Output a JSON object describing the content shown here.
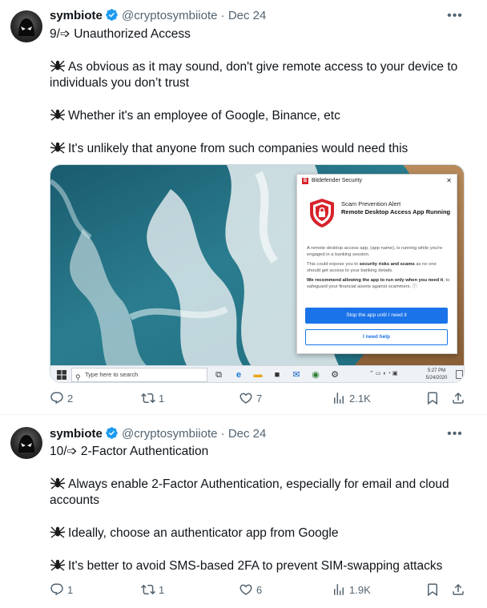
{
  "tweets": [
    {
      "author": {
        "name": "symbiote",
        "handle": "@cryptosymbiiote",
        "separator": "·",
        "date": "Dec 24"
      },
      "title": "9/➩ Unauthorized Access",
      "paragraphs": [
        "As obvious as it may sound, don't give remote access to your device to individuals you don’t trust",
        "Whether it's an employee of Google, Binance, etc",
        "It's unlikely that anyone from such companies would need this"
      ],
      "stats": {
        "replies": "2",
        "reposts": "1",
        "likes": "7",
        "views": "2.1K"
      }
    },
    {
      "author": {
        "name": "symbiote",
        "handle": "@cryptosymbiiote",
        "separator": "·",
        "date": "Dec 24"
      },
      "title": "10/➩ 2-Factor Authentication",
      "paragraphs": [
        "Always enable 2-Factor Authentication, especially for email and cloud accounts",
        "Ideally, choose an authenticator app from Google",
        "It's better to avoid SMS-based 2FA to prevent SIM-swapping attacks"
      ],
      "stats": {
        "replies": "1",
        "reposts": "1",
        "likes": "6",
        "views": "1.9K"
      }
    }
  ],
  "media": {
    "popup": {
      "app_title": "Bitdefender Security",
      "close": "✕",
      "alert_title": "Scam Prevention Alert",
      "alert_subtitle": "Remote Desktop Access App Running",
      "body_1": "A remote desktop access app, (app name), is running while you're engaged in a banking session.",
      "body_2_pre": "This could expose you to ",
      "body_2_bold": "security risks and scams",
      "body_2_post": " as no one should get access to your banking details.",
      "body_3_bold": "We recommend allowing the app to run only when you need it",
      "body_3_post": ", to safeguard your financial assets against scammers. ⓘ",
      "primary_button": "Stop the app until I need it",
      "secondary_button": "I need help"
    },
    "taskbar": {
      "search_placeholder": "Type here to search",
      "time": "5:27 PM",
      "date": "5/24/2020"
    }
  },
  "colors": {
    "text": "#0f1419",
    "secondary": "#536471",
    "verified": "#1d9bf0",
    "button_blue": "#1a73e8",
    "bitdefender_red": "#d6232a"
  },
  "icons": [
    "verified-icon",
    "more-icon",
    "spider-icon",
    "reply-icon",
    "repost-icon",
    "like-icon",
    "views-icon",
    "bookmark-icon",
    "share-icon"
  ]
}
